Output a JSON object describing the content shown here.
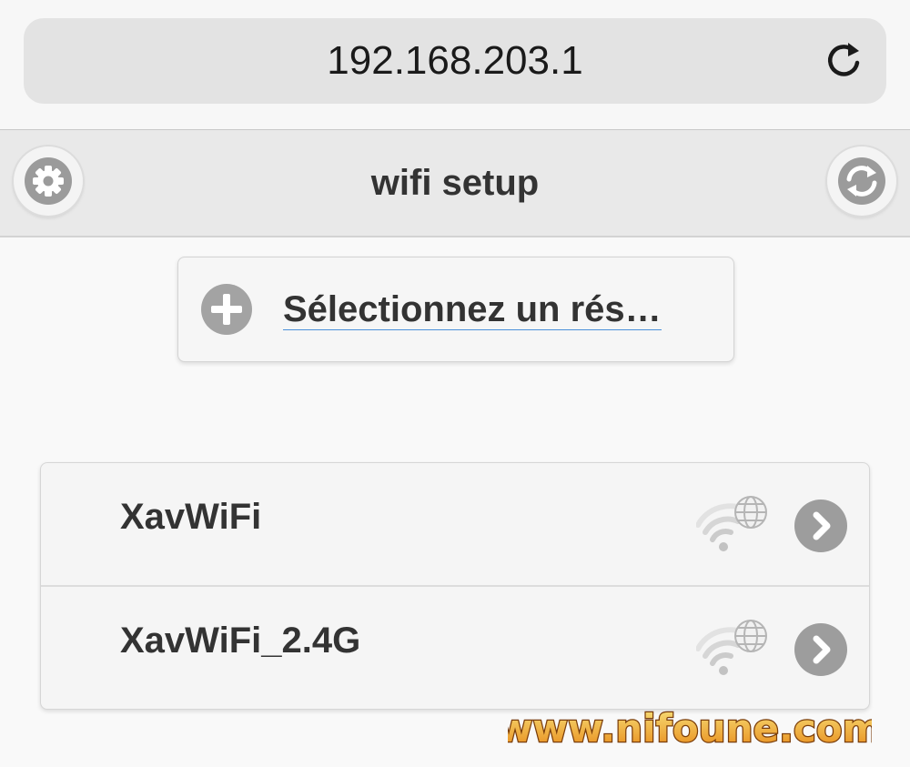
{
  "browser": {
    "url": "192.168.203.1",
    "reload_icon": "reload-icon"
  },
  "header": {
    "title": "wifi setup",
    "left_icon": "gear-icon",
    "right_icon": "refresh-icon"
  },
  "select_network": {
    "label": "Sélectionnez un rés…",
    "icon": "plus-icon"
  },
  "networks": [
    {
      "name": "XavWiFi",
      "signal_icon": "wifi-globe-icon",
      "action_icon": "chevron-right-icon"
    },
    {
      "name": "XavWiFi_2.4G",
      "signal_icon": "wifi-globe-icon",
      "action_icon": "chevron-right-icon"
    }
  ],
  "watermark": {
    "text": "www.nifoune.com",
    "colors": {
      "fill_top": "#f7e27a",
      "fill_bottom": "#e88a1a",
      "outline": "#7a3d0a"
    }
  }
}
